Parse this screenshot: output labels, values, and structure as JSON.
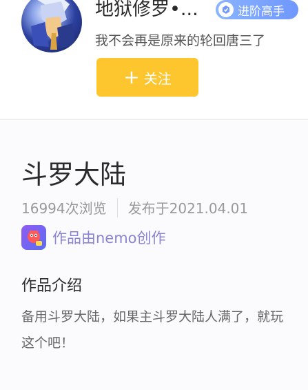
{
  "author": {
    "name": "地狱修罗•...",
    "badge_label": "进阶高手",
    "bio": "我不会再是原来的轮回唐三了",
    "follow_label": "关注",
    "follow_icon": "plus-icon",
    "avatar_icon": "avatar-anime-character"
  },
  "work": {
    "title": "斗罗大陆",
    "views": "16994次浏览",
    "published": "发布于2021.04.01",
    "creator_label": "作品由nemo创作",
    "creator_icon": "nemo-app-icon",
    "intro_heading": "作品介绍",
    "intro_text": "备用斗罗大陆，如果主斗罗大陆人满了，就玩这个吧！"
  },
  "colors": {
    "follow_button": "#fdc62f",
    "badge": "#7aa3ff",
    "creator_link": "#8a84d4"
  }
}
